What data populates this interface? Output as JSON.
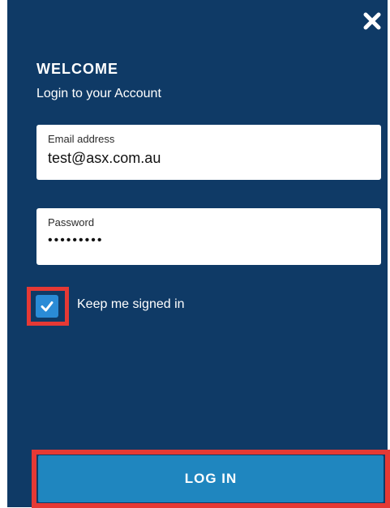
{
  "modal": {
    "heading": "WELCOME",
    "subheading": "Login to your Account",
    "close_icon": "close-icon"
  },
  "form": {
    "email": {
      "label": "Email address",
      "value": "test@asx.com.au"
    },
    "password": {
      "label": "Password",
      "value": "•••••••••"
    },
    "keep_signed_in": {
      "label": "Keep me signed in",
      "checked": true,
      "icon": "checkmark-icon"
    },
    "submit_label": "LOG IN"
  },
  "colors": {
    "panel_bg": "#0f3a66",
    "button_bg": "#1f86bf",
    "checkbox_bg": "#2a8bd6",
    "highlight": "#e53935"
  }
}
